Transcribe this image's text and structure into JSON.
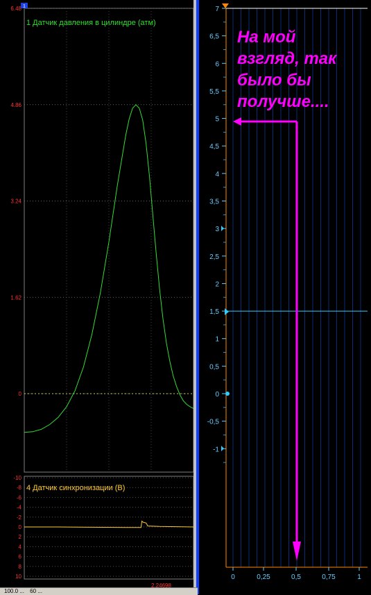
{
  "left_panel": {
    "top_chart": {
      "title": "1 Датчик давления в цилиндре (атм)",
      "tick_labels": [
        "6.48",
        "4.86",
        "3.24",
        "1.62",
        "0"
      ],
      "marker_label": "1"
    },
    "bottom_chart": {
      "title": "4 Датчик синхронизации (В)",
      "tick_labels": [
        "-10",
        "-8",
        "-6",
        "-4",
        "-2",
        "0",
        "2",
        "4",
        "6",
        "8",
        "10"
      ],
      "cursor_readout": "2.24698"
    },
    "status_bar": [
      "100.0 ...",
      "60 ..."
    ]
  },
  "right_panel": {
    "y_tick_labels": [
      "7",
      "6,5",
      "6",
      "5,5",
      "5",
      "4,5",
      "4",
      "3,5",
      "3",
      "2,5",
      "2",
      "1,5",
      "1",
      "0,5",
      "0",
      "-0,5",
      "-1"
    ],
    "x_tick_labels": [
      "0",
      "0,25",
      "0,5",
      "0,75",
      "1"
    ],
    "annotation_lines": [
      "На мой",
      "взгляд, так",
      "было бы",
      "получше...."
    ]
  },
  "colors": {
    "background": "#000000",
    "pressure_trace": "#33dd33",
    "sync_trace": "#ffcc33",
    "left_axis_tick": "#ff3333",
    "right_axis_tick": "#66ccff",
    "orange_axis": "#ff8800",
    "annotation": "#ff00ff",
    "window_border": "#1040ff"
  },
  "chart_data": [
    {
      "type": "line",
      "title": "1 Датчик давления в цилиндре (атм)",
      "ylim": [
        -1.3,
        6.48
      ],
      "yticks": [
        0,
        1.62,
        3.24,
        4.86,
        6.48
      ],
      "x": [
        0,
        0.05,
        0.1,
        0.15,
        0.2,
        0.25,
        0.3,
        0.35,
        0.4,
        0.45,
        0.5,
        0.55,
        0.6,
        0.62,
        0.64,
        0.66,
        0.68,
        0.7,
        0.72,
        0.74,
        0.76,
        0.78,
        0.8,
        0.82,
        0.84,
        0.86,
        0.88,
        0.9,
        0.92,
        0.94,
        0.96,
        0.98,
        1.0
      ],
      "values": [
        -0.65,
        -0.64,
        -0.6,
        -0.52,
        -0.4,
        -0.22,
        0.05,
        0.45,
        1.0,
        1.7,
        2.55,
        3.5,
        4.35,
        4.62,
        4.8,
        4.86,
        4.8,
        4.6,
        4.2,
        3.65,
        3.0,
        2.35,
        1.75,
        1.25,
        0.85,
        0.55,
        0.3,
        0.12,
        -0.02,
        -0.12,
        -0.18,
        -0.22,
        -0.25
      ]
    },
    {
      "type": "line",
      "title": "4 Датчик синхронизации (В)",
      "ylim": [
        -10,
        10
      ],
      "y_inverted": true,
      "x": [
        0,
        0.2,
        0.4,
        0.6,
        0.69,
        0.695,
        0.7,
        0.72,
        0.73,
        0.8,
        0.9,
        1.0
      ],
      "values": [
        0,
        0,
        0.05,
        0.1,
        0.1,
        -1.2,
        -1.0,
        -0.8,
        -0.2,
        -0.1,
        -0.05,
        0
      ]
    },
    {
      "type": "line",
      "ylim": [
        -1.5,
        7
      ],
      "xlim": [
        -0.05,
        1
      ],
      "yticks": [
        -1,
        -0.5,
        0,
        0.5,
        1,
        1.5,
        2,
        2.5,
        3,
        3.5,
        4,
        4.5,
        5,
        5.5,
        6,
        6.5,
        7
      ],
      "xticks": [
        0,
        0.25,
        0.5,
        0.75,
        1
      ],
      "grid": true,
      "series": [
        {
          "values": [
            1.5,
            1.5
          ]
        }
      ],
      "x": [
        -0.05,
        1
      ],
      "annotation": {
        "text": "На мой взгляд, так было бы получше....",
        "arrow_to_y": 5,
        "arrow_at_x": 0.5
      }
    }
  ]
}
